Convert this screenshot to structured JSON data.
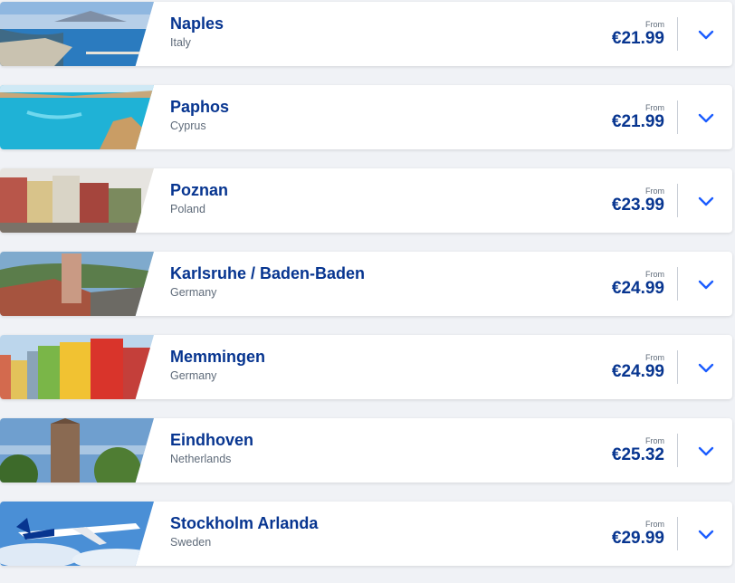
{
  "price_prefix": "From",
  "destinations": [
    {
      "city": "Naples",
      "country": "Italy",
      "price": "€21.99",
      "image": "coastal-bay-photo"
    },
    {
      "city": "Paphos",
      "country": "Cyprus",
      "price": "€21.99",
      "image": "turquoise-sea-rocks-photo"
    },
    {
      "city": "Poznan",
      "country": "Poland",
      "price": "€23.99",
      "image": "old-town-square-photo"
    },
    {
      "city": "Karlsruhe / Baden-Baden",
      "country": "Germany",
      "price": "€24.99",
      "image": "town-rooftops-tower-photo"
    },
    {
      "city": "Memmingen",
      "country": "Germany",
      "price": "€24.99",
      "image": "colorful-houses-photo"
    },
    {
      "city": "Eindhoven",
      "country": "Netherlands",
      "price": "€25.32",
      "image": "church-tower-photo"
    },
    {
      "city": "Stockholm Arlanda",
      "country": "Sweden",
      "price": "€29.99",
      "image": "airplane-in-sky-photo"
    }
  ],
  "colors": {
    "brand_blue": "#073590",
    "accent_blue": "#1a5cff",
    "muted_text": "#5f6b7a",
    "page_bg": "#f0f2f6"
  }
}
